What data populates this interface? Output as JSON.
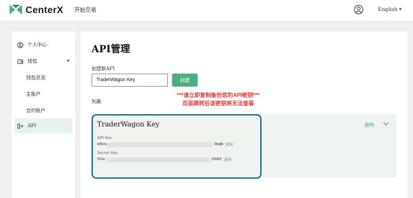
{
  "header": {
    "brand": "CenterX",
    "nav_trade": "开始交易",
    "language": "English"
  },
  "sidebar": {
    "items": [
      {
        "label": "个人中心",
        "icon": "user-icon"
      },
      {
        "label": "钱包",
        "icon": "wallet-icon"
      },
      {
        "label": "钱包总览"
      },
      {
        "label": "主账户"
      },
      {
        "label": "合约账户"
      },
      {
        "label": "API",
        "icon": "api-icon",
        "active": true
      }
    ]
  },
  "main": {
    "title": "API管理",
    "create_label": "创建新API",
    "input_value": "TraderWagon Key",
    "create_button": "创建",
    "warning_line1": "***请立即复制备份您的API密钥***",
    "warning_line2": "页面跳转后该密钥将无法查看",
    "list_label": "列表",
    "card": {
      "title": "TraderWagon Key",
      "delete": "删除",
      "api_key_label": "API Key",
      "api_key_prefix": "hRcu",
      "api_key_suffix": "3nqh",
      "secret_key_label": "Secret Key",
      "secret_key_prefix": "VOe",
      "secret_key_suffix": "IHKF",
      "copy": "复制"
    }
  },
  "colors": {
    "accent": "#4caf84",
    "warning": "#e53935",
    "highlight_border": "#1c6f9c"
  }
}
